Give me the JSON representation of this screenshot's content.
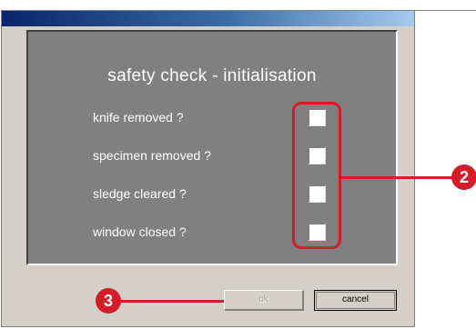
{
  "dialog": {
    "title": "safety check - initialisation",
    "checks": [
      {
        "label": "knife removed ?",
        "checked": false
      },
      {
        "label": "specimen removed ?",
        "checked": false
      },
      {
        "label": "sledge cleared ?",
        "checked": false
      },
      {
        "label": "window closed ?",
        "checked": false
      }
    ],
    "ok_label": "ok",
    "ok_enabled": false,
    "cancel_label": "cancel"
  },
  "annotations": {
    "callout_checkboxes": "2",
    "callout_ok": "3",
    "color": "#d51c2a"
  }
}
